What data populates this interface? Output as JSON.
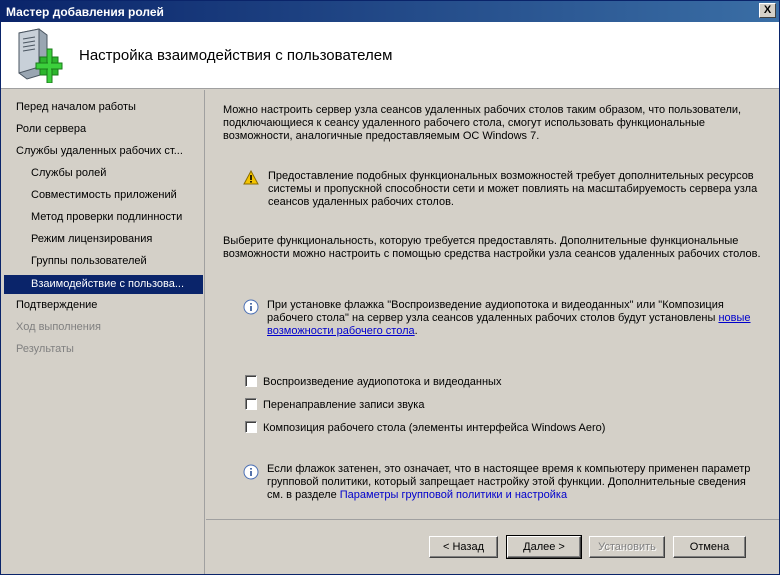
{
  "window": {
    "title": "Мастер добавления ролей",
    "close_glyph": "X"
  },
  "header": {
    "title": "Настройка взаимодействия с пользователем",
    "icon": "server-add-icon"
  },
  "sidebar": {
    "items": [
      {
        "label": "Перед началом работы",
        "state": "normal"
      },
      {
        "label": "Роли сервера",
        "state": "normal"
      },
      {
        "label": "Службы удаленных рабочих ст...",
        "state": "normal"
      },
      {
        "label": "Службы ролей",
        "state": "sub"
      },
      {
        "label": "Совместимость приложений",
        "state": "sub"
      },
      {
        "label": "Метод проверки подлинности",
        "state": "sub"
      },
      {
        "label": "Режим лицензирования",
        "state": "sub"
      },
      {
        "label": "Группы пользователей",
        "state": "sub"
      },
      {
        "label": "Взаимодействие с пользова...",
        "state": "active"
      },
      {
        "label": "Подтверждение",
        "state": "normal"
      },
      {
        "label": "Ход выполнения",
        "state": "disabled"
      },
      {
        "label": "Результаты",
        "state": "disabled"
      }
    ]
  },
  "content": {
    "intro": "Можно настроить сервер узла сеансов удаленных рабочих столов таким образом, что пользователи, подключающиеся к сеансу удаленного рабочего стола, смогут использовать функциональные возможности, аналогичные предоставляемым ОС Windows 7.",
    "warning": "Предоставление подобных функциональных возможностей требует дополнительных ресурсов системы и пропускной способности сети и может повлиять на масштабируемость сервера узла сеансов удаленных рабочих столов.",
    "select_text": "Выберите функциональность, которую требуется предоставлять. Дополнительные функциональные возможности можно настроить с помощью средства настройки узла сеансов удаленных рабочих столов.",
    "info1_text": "При установке флажка \"Воспроизведение аудиопотока и видеоданных\" или \"Композиция рабочего стола\" на сервер узла сеансов удаленных рабочих столов будут установлены",
    "info1_link": "новые возможности рабочего стола",
    "info1_end": ".",
    "checkboxes": [
      {
        "label": "Воспроизведение аудиопотока и видеоданных",
        "checked": false
      },
      {
        "label": "Перенаправление записи звука",
        "checked": false
      },
      {
        "label": "Композиция рабочего стола (элементы интерфейса Windows Aero)",
        "checked": false
      }
    ],
    "info2_text": "Если флажок затенен, это означает, что в настоящее время к компьютеру применен параметр групповой политики, который запрещает настройку этой функции. Дополнительные сведения см. в разделе",
    "info2_link": "Параметры групповой политики и настройка"
  },
  "buttons": {
    "back": "< Назад",
    "next": "Далее >",
    "install": "Установить",
    "cancel": "Отмена"
  },
  "colors": {
    "title_bar": "#0a246a",
    "selected_item": "#0a246a",
    "link": "#0000cc",
    "warning": "#f5c400"
  }
}
